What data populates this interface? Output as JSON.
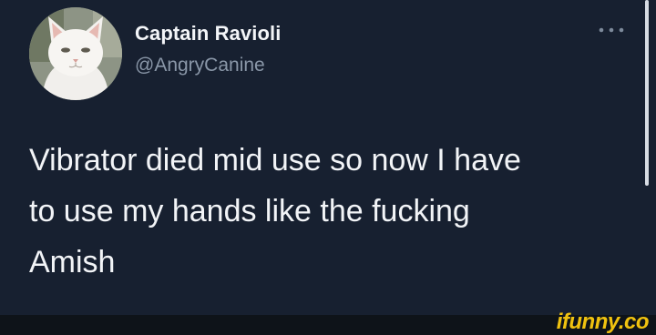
{
  "tweet": {
    "display_name": "Captain Ravioli",
    "handle": "@AngryCanine",
    "text": "Vibrator died mid use so now I have\nto use my hands like the fucking\nAmish",
    "avatar_icon": "white-cat-avatar",
    "more_icon": "more-options-icon"
  },
  "watermark": {
    "text": "ifunny.co"
  },
  "colors": {
    "background": "#172030",
    "name": "#f3f5f8",
    "handle": "#8a97a8",
    "watermark": "#f0c20f"
  }
}
